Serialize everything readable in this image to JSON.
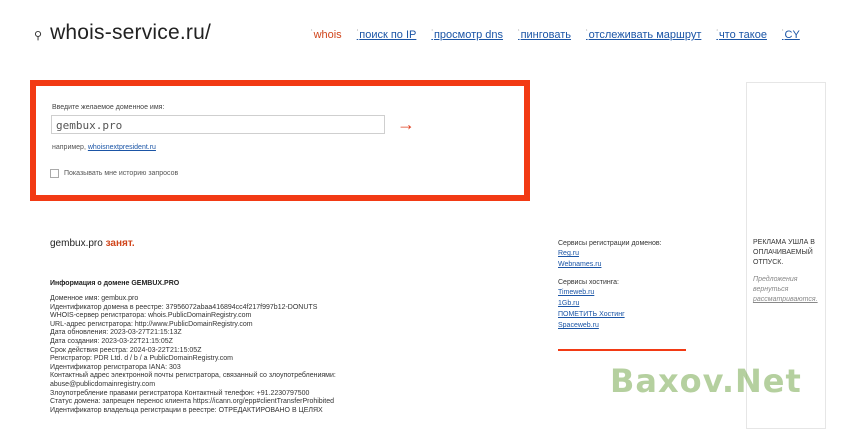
{
  "logo": {
    "icon": "key-icon",
    "text": "whois-service.ru/"
  },
  "nav": [
    {
      "label": "whois"
    },
    {
      "label": "поиск по IP"
    },
    {
      "label": "просмотр dns"
    },
    {
      "label": "пинговать"
    },
    {
      "label": "отслеживать маршрут"
    },
    {
      "label": "что такое"
    },
    {
      "label": "CY"
    }
  ],
  "search": {
    "label": "Введите желаемое доменное имя:",
    "value": "gembux.pro",
    "example_prefix": "например,",
    "example_link": "whoisnextpresident.ru",
    "history_label": "Показывать мне историю запросов",
    "accent_color": "#f23a14"
  },
  "result": {
    "domain": "gembux.pro",
    "status": "занят."
  },
  "info": {
    "title": "Информация о домене GEMBUX.PRO",
    "lines": [
      "Доменное имя: gembux.pro",
      "Идентификатор домена в реестре: 37956072abaa416894cc4f217f997b12-DONUTS",
      "WHOIS-сервер регистратора: whois.PublicDomainRegistry.com",
      "URL-адрес регистратора: http://www.PublicDomainRegistry.com",
      "Дата обновления: 2023-03-27T21:15:13Z",
      "Дата создания: 2023-03-22T21:15:05Z",
      "Срок действия реестра: 2024-03-22T21:15:05Z",
      "Регистратор: PDR Ltd. d / b / a PublicDomainRegistry.com",
      "Идентификатор регистратора IANA: 303",
      "Контактный адрес электронной почты регистратора, связанный со злоупотреблениями:",
      "abuse@publicdomainregistry.com",
      "Злоупотребление правами регистратора Контактный телефон: +91.2230797500",
      "Статус домена: запрещен перенос клиента https://icann.org/epp#clientTransferProhibited",
      "Идентификатор владельца регистрации в реестре: ОТРЕДАКТИРОВАНО В ЦЕЛЯХ"
    ]
  },
  "services": {
    "registration_title": "Сервисы регистрации доменов:",
    "registration": [
      "Reg.ru",
      "Webnames.ru"
    ],
    "hosting_title": "Сервисы хостинга:",
    "hosting": [
      "Timeweb.ru",
      "1Gb.ru",
      "ПОМЕТИТЬ Хостинг",
      "Spaceweb.ru"
    ]
  },
  "ad": {
    "title": "РЕКЛАМА УШЛА В ОПЛАЧИВАЕМЫЙ ОТПУСК.",
    "sub_prefix": "Предложения вернуться",
    "sub_link": "рассматриваются."
  },
  "watermark": "Baxov.Net"
}
